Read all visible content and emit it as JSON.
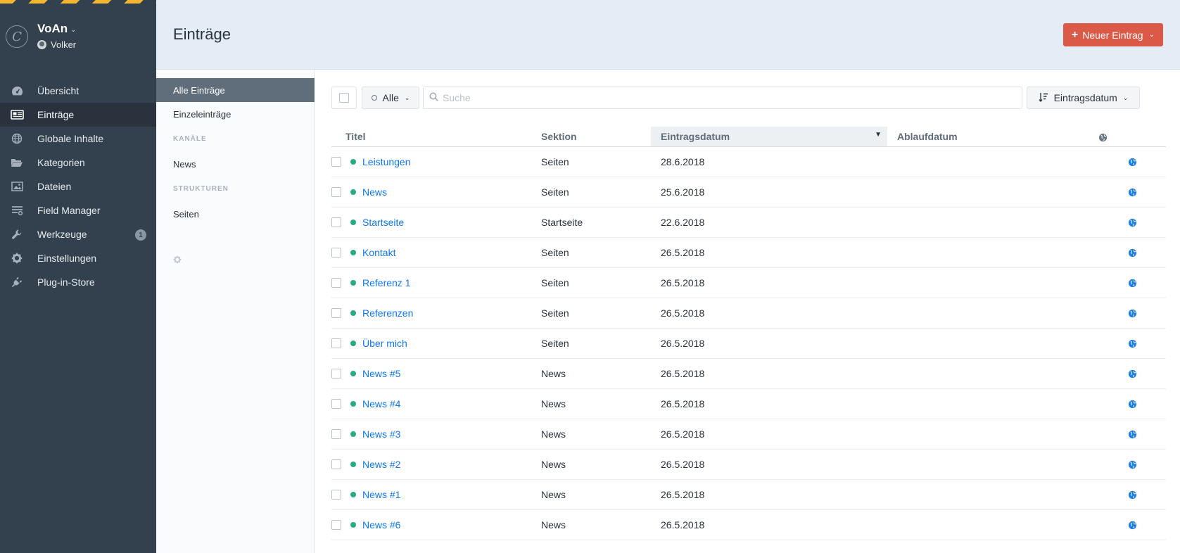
{
  "site": {
    "name": "VoAn",
    "logo_letter": "C",
    "user": "Volker"
  },
  "nav": [
    {
      "label": "Übersicht",
      "icon": "dashboard-icon",
      "active": false
    },
    {
      "label": "Einträge",
      "icon": "entries-icon",
      "active": true
    },
    {
      "label": "Globale Inhalte",
      "icon": "globe-icon",
      "active": false
    },
    {
      "label": "Kategorien",
      "icon": "folder-icon",
      "active": false
    },
    {
      "label": "Dateien",
      "icon": "image-icon",
      "active": false
    },
    {
      "label": "Field Manager",
      "icon": "field-manager-icon",
      "active": false
    },
    {
      "label": "Werkzeuge",
      "icon": "wrench-icon",
      "active": false,
      "badge": "1"
    },
    {
      "label": "Einstellungen",
      "icon": "gear-icon",
      "active": false
    },
    {
      "label": "Plug-in-Store",
      "icon": "plug-icon",
      "active": false
    }
  ],
  "header": {
    "title": "Einträge",
    "new_entry_label": "Neuer Eintrag"
  },
  "sources": {
    "all_label": "Alle Einträge",
    "singles_label": "Einzeleinträge",
    "channels_heading": "Kanäle",
    "channels": [
      "News"
    ],
    "structures_heading": "Strukturen",
    "structures": [
      "Seiten"
    ]
  },
  "toolbar": {
    "status_label": "Alle",
    "search_placeholder": "Suche",
    "sort_label": "Eintragsdatum"
  },
  "table": {
    "columns": {
      "title": "Titel",
      "section": "Sektion",
      "post_date": "Eintragsdatum",
      "expiry_date": "Ablaufdatum"
    },
    "rows": [
      {
        "title": "Leistungen",
        "section": "Seiten",
        "post_date": "28.6.2018",
        "expiry_date": ""
      },
      {
        "title": "News",
        "section": "Seiten",
        "post_date": "25.6.2018",
        "expiry_date": ""
      },
      {
        "title": "Startseite",
        "section": "Startseite",
        "post_date": "22.6.2018",
        "expiry_date": ""
      },
      {
        "title": "Kontakt",
        "section": "Seiten",
        "post_date": "26.5.2018",
        "expiry_date": ""
      },
      {
        "title": "Referenz 1",
        "section": "Seiten",
        "post_date": "26.5.2018",
        "expiry_date": ""
      },
      {
        "title": "Referenzen",
        "section": "Seiten",
        "post_date": "26.5.2018",
        "expiry_date": ""
      },
      {
        "title": "Über mich",
        "section": "Seiten",
        "post_date": "26.5.2018",
        "expiry_date": ""
      },
      {
        "title": "News #5",
        "section": "News",
        "post_date": "26.5.2018",
        "expiry_date": ""
      },
      {
        "title": "News #4",
        "section": "News",
        "post_date": "26.5.2018",
        "expiry_date": ""
      },
      {
        "title": "News #3",
        "section": "News",
        "post_date": "26.5.2018",
        "expiry_date": ""
      },
      {
        "title": "News #2",
        "section": "News",
        "post_date": "26.5.2018",
        "expiry_date": ""
      },
      {
        "title": "News #1",
        "section": "News",
        "post_date": "26.5.2018",
        "expiry_date": ""
      },
      {
        "title": "News #6",
        "section": "News",
        "post_date": "26.5.2018",
        "expiry_date": ""
      }
    ]
  },
  "colors": {
    "sidebar_bg": "#33404d",
    "accent_red": "#da5a47",
    "link_blue": "#0d78f2",
    "status_green": "#27ab83",
    "header_bg": "#e4edf5"
  }
}
